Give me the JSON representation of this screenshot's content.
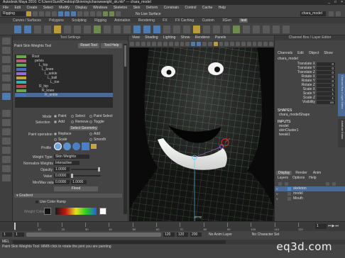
{
  "window": {
    "title": "Autodesk Maya 2016: C:\\Users\\Sunil\\Desktop\\Skinning\\charswweight_ok.mb* --- chara_model",
    "controls": [
      "_",
      "□",
      "×"
    ]
  },
  "menubar": [
    "File",
    "Edit",
    "Create",
    "Select",
    "Modify",
    "Display",
    "Windows",
    "Skeleton",
    "Skin",
    "Deform",
    "Constrain",
    "Control",
    "Cache",
    "Help"
  ],
  "statusline": {
    "mode": "Rigging",
    "live_surface": "No Live Surface",
    "search_field": "chara_model"
  },
  "shelf_tabs": [
    {
      "label": "Curves / Surfaces",
      "active": false
    },
    {
      "label": "Polygons",
      "active": false
    },
    {
      "label": "Sculpting",
      "active": false
    },
    {
      "label": "Rigging",
      "active": false
    },
    {
      "label": "Animation",
      "active": false
    },
    {
      "label": "Rendering",
      "active": false
    },
    {
      "label": "FX",
      "active": false
    },
    {
      "label": "FX Caching",
      "active": false
    },
    {
      "label": "Custom",
      "active": false
    },
    {
      "label": "XGen",
      "active": false
    },
    {
      "label": "test",
      "active": true
    }
  ],
  "tool_settings": {
    "header": "Tool Settings",
    "title": "Paint Skin Weights Tool",
    "reset_button": "Reset Tool",
    "help_button": "Tool Help",
    "influences": [
      {
        "name": "Root",
        "color": "#6aa84f"
      },
      {
        "name": "pelvis",
        "color": "#b85a8a"
      },
      {
        "name": "L_hip",
        "color": "#6aa84f"
      },
      {
        "name": "L_knee",
        "color": "#4a6fbf"
      },
      {
        "name": "L_ankle",
        "color": "#9b6ad1"
      },
      {
        "name": "L_ball",
        "color": "#c8a43e"
      },
      {
        "name": "L_toe",
        "color": "#3fb0b0"
      },
      {
        "name": "R_hip",
        "color": "#b84a4a"
      },
      {
        "name": "R_knee",
        "color": "#6aa84f"
      },
      {
        "name": "R_ankle",
        "color": "#4a6fbf"
      }
    ],
    "mode_label": "Mode",
    "mode_options": [
      "Paint",
      "Select",
      "Paint Select"
    ],
    "selection_label": "Selection",
    "selection_options": [
      "Add",
      "Remove",
      "Toggle"
    ],
    "select_geometry_button": "Select Geometry",
    "paint_operation_label": "Paint operation",
    "paint_operations": [
      "Replace",
      "Add",
      "Scale",
      "Smooth"
    ],
    "profile_label": "Profile",
    "weight_type_label": "Weight Type",
    "weight_type_value": "Skin Weights",
    "normalize_label": "Normalize Weights",
    "normalize_value": "Interactive",
    "opacity_label": "Opacity",
    "opacity_value": "1.0000",
    "value_label": "Value",
    "value_value": "0.0000",
    "minmax_label": "Min/Max value",
    "min_value": "0.0000",
    "max_value": "1.0000",
    "flood_button": "Flood",
    "gradient_section": "Gradient",
    "use_color_ramp_label": "Use Color Ramp",
    "weight_color_label": "Weight Color:",
    "ramp_colors": [
      "#1a1a1a",
      "#c81414",
      "#e8e020",
      "#20d020",
      "#2060e0",
      "#ffffff"
    ]
  },
  "viewport": {
    "menu": [
      "View",
      "Shading",
      "Lighting",
      "Show",
      "Renderer",
      "Panels"
    ],
    "camera_label": "persp"
  },
  "channel_box": {
    "header": "Channel Box / Layer Editor",
    "menu": [
      "Channels",
      "Edit",
      "Object",
      "Show"
    ],
    "object_name": "chara_model",
    "attributes": [
      {
        "label": "Translate X",
        "value": "0"
      },
      {
        "label": "Translate Y",
        "value": "0"
      },
      {
        "label": "Translate Z",
        "value": "0"
      },
      {
        "label": "Rotate X",
        "value": "0"
      },
      {
        "label": "Rotate Y",
        "value": "0"
      },
      {
        "label": "Rotate Z",
        "value": "0"
      },
      {
        "label": "Scale X",
        "value": "1"
      },
      {
        "label": "Scale Y",
        "value": "1"
      },
      {
        "label": "Scale Z",
        "value": "1"
      },
      {
        "label": "Visibility",
        "value": "on"
      }
    ],
    "shapes_header": "SHAPES",
    "shape_name": "chara_modelShape",
    "inputs_header": "INPUTS",
    "inputs": [
      "model",
      "skinCluster1",
      "tweak1"
    ]
  },
  "layer_editor": {
    "tabs": [
      "Display",
      "Render",
      "Anim"
    ],
    "menu": [
      "Layers",
      "Options",
      "Help"
    ],
    "layers": [
      {
        "vis": "V",
        "name": "skeleton",
        "color": "#4a8fd6",
        "selected": true
      },
      {
        "vis": "V",
        "name": "model",
        "color": "#5a5a5a",
        "selected": false
      },
      {
        "vis": "V",
        "name": "Mouth",
        "color": "#5a5a5a",
        "selected": false
      }
    ],
    "side_tabs": [
      "Channel Box / Layer Editor",
      "Attribute Editor"
    ]
  },
  "time_slider": {
    "ticks": [
      "1",
      "10",
      "20",
      "30",
      "40",
      "50",
      "60",
      "70",
      "80",
      "90",
      "100",
      "110",
      "120"
    ],
    "current_frame": "1"
  },
  "range_slider": {
    "start": "1",
    "inner_start": "1",
    "inner_end": "120",
    "end": "120",
    "end2": "200",
    "anim_layer": "No Anim Layer",
    "char_set": "No Character Set"
  },
  "mel_label": "MEL",
  "help_line": "Paint Skin Weights Tool: MMB click to rotate the joint you are painting",
  "watermark": "eq3d.com"
}
